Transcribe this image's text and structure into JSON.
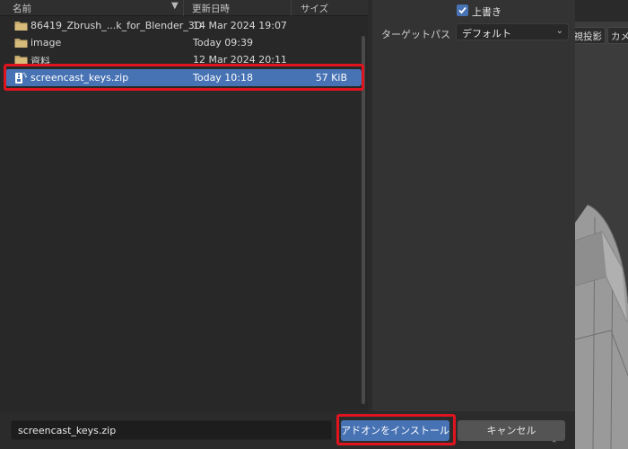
{
  "columns": {
    "name": "名前",
    "modified": "更新日時",
    "size": "サイズ"
  },
  "files": [
    {
      "name": "86419_Zbrush_...k_for_Blender_3D",
      "modified": "14 Mar 2024 19:07",
      "size": "",
      "type": "folder-icon"
    },
    {
      "name": "image",
      "modified": "Today 09:39",
      "size": "",
      "type": "folder-icon"
    },
    {
      "name": "資料",
      "modified": "12 Mar 2024 20:11",
      "size": "",
      "type": "folder-icon"
    },
    {
      "name": "screencast_keys.zip",
      "modified": "Today 10:18",
      "size": "57 KiB",
      "type": "zip-archive-icon",
      "selected": true
    }
  ],
  "options": {
    "overwrite_label": "上書き",
    "overwrite_checked": true,
    "target_path_label": "ターゲットパス",
    "target_path_value": "デフォルト"
  },
  "viewport": {
    "shading_button": "透視投影",
    "view_button": "カメラ"
  },
  "bottom": {
    "filename_value": "screencast_keys.zip",
    "install_label": "アドオンをインストール",
    "cancel_label": "キャンセル"
  },
  "colors": {
    "accent": "#4772b3",
    "highlight": "#e0141e"
  }
}
